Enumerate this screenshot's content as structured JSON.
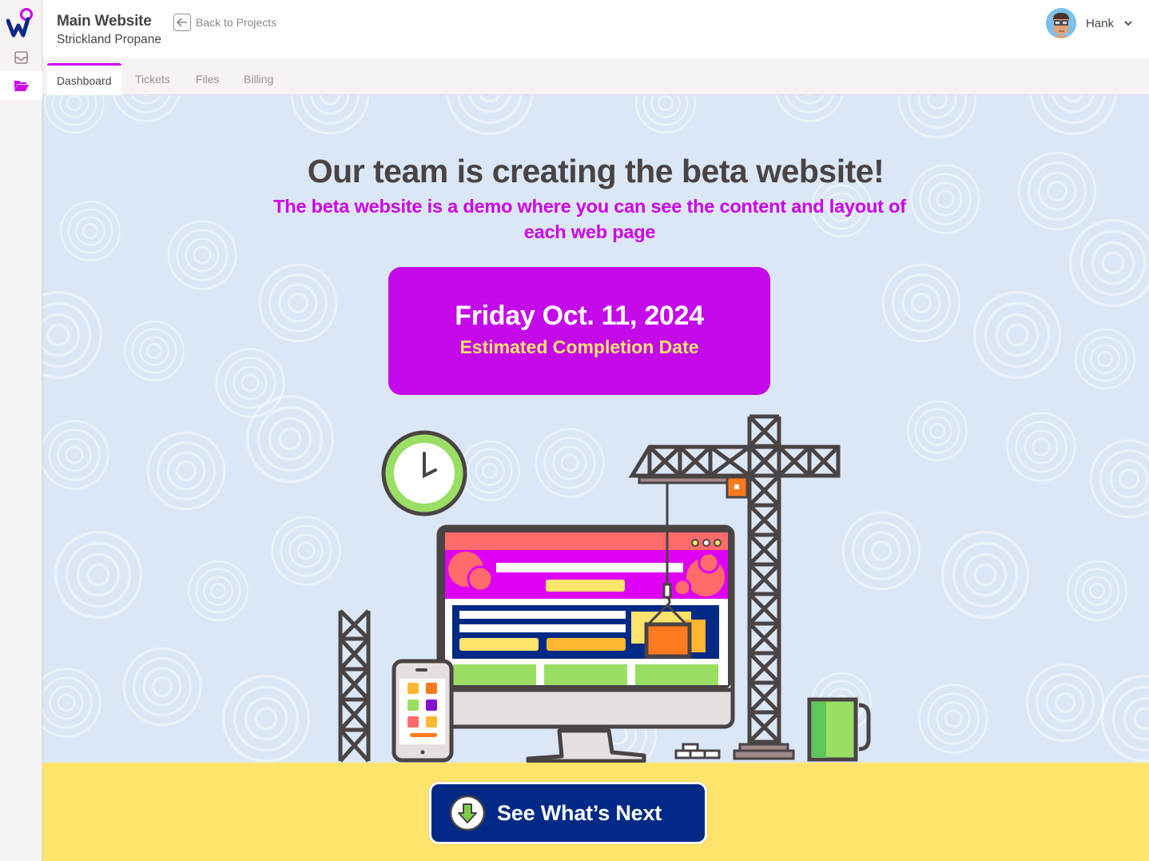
{
  "app": {
    "logo": "wordsmith-logo",
    "rail": [
      {
        "name": "inbox",
        "icon": "inbox-icon",
        "active": false
      },
      {
        "name": "projects",
        "icon": "folder-open-icon",
        "active": true
      }
    ]
  },
  "header": {
    "project_title": "Main Website",
    "client_name": "Strickland Propane",
    "back_label": "Back to Projects",
    "back_icon": "arrow-left-icon",
    "user": {
      "name": "Hank",
      "avatar": "avatar",
      "menu_icon": "chevron-down-icon"
    }
  },
  "tabs": [
    {
      "label": "Dashboard",
      "active": true
    },
    {
      "label": "Tickets",
      "active": false
    },
    {
      "label": "Files",
      "active": false
    },
    {
      "label": "Billing",
      "active": false
    }
  ],
  "main": {
    "headline": "Our team is creating the beta website!",
    "subline": "The beta website is a demo where you can see the content and layout of each web page",
    "completion": {
      "date": "Friday Oct. 11, 2024",
      "caption": "Estimated Completion Date"
    },
    "illustration": "website-under-construction-illustration"
  },
  "cta": {
    "label": "See What’s Next",
    "icon": "arrow-down-circle-icon"
  },
  "colors": {
    "accent": "#cc00e8",
    "card": "#c409ea",
    "caption_yellow": "#ffe36b",
    "background_blue": "#dbe7f6",
    "footer_yellow": "#ffe46c",
    "cta_navy": "#002a86",
    "text_dark": "#4a4344"
  }
}
